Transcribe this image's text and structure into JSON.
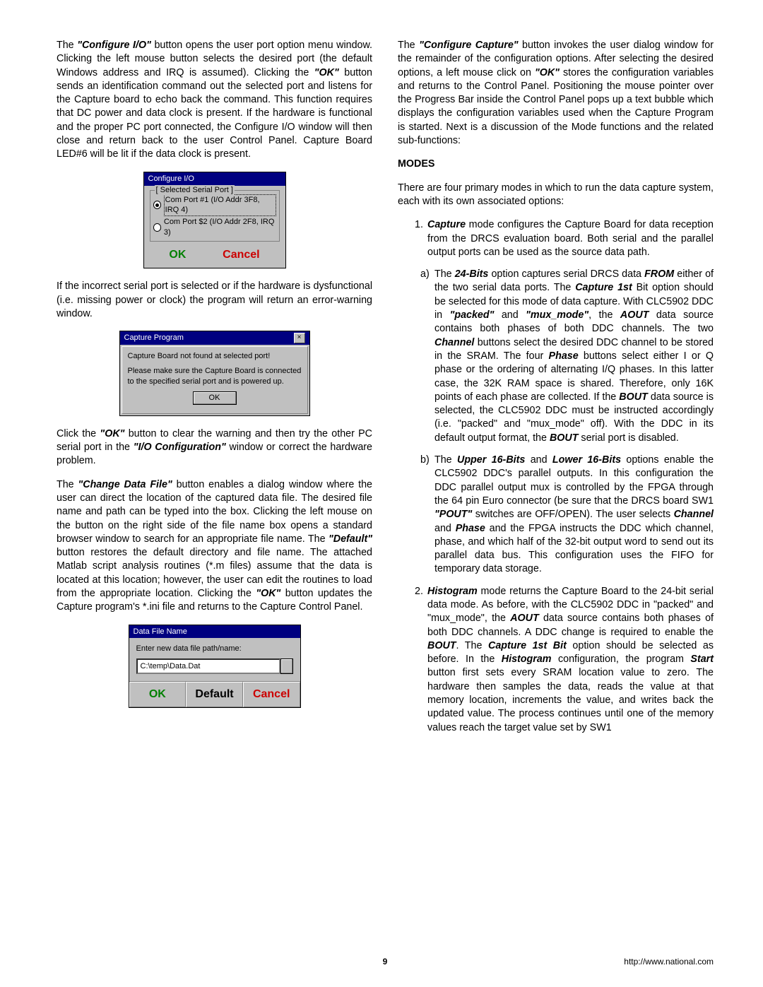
{
  "left": {
    "p1_pre": "The ",
    "p1_cfgio": "\"Configure I/O\"",
    "p1_mid": " button opens the user port option menu window. Clicking the left mouse button selects the desired port (the default Windows address and IRQ is assumed). Clicking the ",
    "p1_ok": "\"OK\"",
    "p1_post": " button sends an identification command out the selected port and listens for the Capture board to echo back the command. This function requires that DC power and data clock is present. If the hardware is functional and the proper PC port connected, the Configure I/O window will then close and return back to the user Control Panel. Capture Board LED#6 will be lit if the data clock is present.",
    "p2": "If the incorrect serial port is selected or if the hardware is dysfunctional (i.e. missing power or clock) the program will return an error-warning window.",
    "p3_pre": "Click the ",
    "p3_ok": "\"OK\"",
    "p3_mid": " button to clear the warning and then try the other PC serial port in the ",
    "p3_iocfg": "\"I/O Configuration\"",
    "p3_post": " window or correct the hardware problem.",
    "p4_pre": "The ",
    "p4_cdf": "\"Change Data File\"",
    "p4_mid": " button enables a dialog window where the user can direct the location of the captured data file. The desired file name and path can be typed into the box. Clicking the left mouse on the button on the right side of the file name box opens a standard browser window to search for an appropriate file name.    The ",
    "p4_def": "\"Default\"",
    "p4_mid2": " button restores the default directory and file name. The attached Matlab script analysis routines (*.m files) assume that the data is located at this location; however, the user can edit the routines to load from the appropriate location. Clicking the ",
    "p4_ok": "\"OK\"",
    "p4_post": " button updates the Capture program's *.ini file and returns to the Capture Control Panel."
  },
  "dlg_io": {
    "title": "Configure I/O",
    "legend": "[ Selected Serial Port ]",
    "opt1": "Com Port #1 (I/O Addr 3F8, IRQ 4)",
    "opt2": "Com Port $2 (I/O Addr 2F8, IRQ 3)",
    "ok": "OK",
    "cancel": "Cancel"
  },
  "dlg_cp": {
    "title": "Capture Program",
    "line1": "Capture Board not found at selected port!",
    "line2": "Please make sure the Capture Board is connected to the specified serial port and is powered up.",
    "ok": "OK"
  },
  "dlg_dfn": {
    "title": "Data File Name",
    "label": "Enter new data file path/name:",
    "value": "C:\\temp\\Data.Dat",
    "ok": "OK",
    "default": "Default",
    "cancel": "Cancel"
  },
  "right": {
    "p1_pre": "The ",
    "p1_cfgcap": "\"Configure Capture\"",
    "p1_mid": " button invokes the user dialog window for the remainder of the configuration options. After selecting the desired options, a left mouse click on ",
    "p1_ok": "\"OK\"",
    "p1_post": " stores the configuration variables and returns to the Control Panel. Positioning the mouse pointer over the Progress Bar inside the Control Panel pops up a text bubble which displays the configuration variables used when the Capture Program is started. Next is a discussion of the Mode functions and the related sub-functions:",
    "modes_head": "MODES",
    "modes_intro": "There are four primary modes in which to run the data capture system, each with its own associated options:",
    "n1_marker": "1.",
    "n1_cap": "Capture",
    "n1_text": " mode configures the Capture Board for data reception from the DRCS evaluation board. Both serial and the parallel output ports can be used as the source data path.",
    "a_marker": "a)",
    "a_pre": "The ",
    "a_24b": "24-Bits",
    "a_m1": " option captures serial DRCS data ",
    "a_from": "FROM",
    "a_m2": " either of the two serial data ports. The ",
    "a_c1st": "Capture 1st",
    "a_m3": " Bit option should be selected for this mode of data capture. With CLC5902 DDC in ",
    "a_pack": "\"packed\"",
    "a_and": " and ",
    "a_mux": "\"mux_mode\"",
    "a_m4": ", the ",
    "a_aout": "AOUT",
    "a_m5": " data source contains both phases of both DDC channels. The two ",
    "a_ch": "Channel",
    "a_m6": " buttons select the desired DDC channel to be stored in the SRAM. The four ",
    "a_ph": "Phase",
    "a_m7": " buttons select either I or Q phase or the ordering of alternating I/Q phases. In this latter case, the 32K RAM space is shared. Therefore, only 16K points of each phase are collected. If the ",
    "a_bout": "BOUT",
    "a_m8": " data source is selected, the CLC5902 DDC must be instructed accordingly (i.e. \"packed\" and \"mux_mode\" off). With the DDC in its default output format, the ",
    "a_bout2": "BOUT",
    "a_m9": " serial port is disabled.",
    "b_marker": "b)",
    "b_pre": "The ",
    "b_u16": "Upper 16-Bits",
    "b_and": " and ",
    "b_l16": "Lower 16-Bits",
    "b_m1": " options enable the CLC5902 DDC's parallel outputs. In this configuration the DDC parallel output mux is controlled by the FPGA through the 64 pin Euro connector (be sure that the DRCS board SW1 ",
    "b_pout": "\"POUT\"",
    "b_m2": " switches are OFF/OPEN). The user selects ",
    "b_ch": "Channel",
    "b_and2": " and ",
    "b_ph": "Phase",
    "b_m3": " and the FPGA instructs the DDC which channel, phase, and which half of the 32-bit output word to send out its parallel data bus. This configuration uses the FIFO for temporary data storage.",
    "n2_marker": "2.",
    "n2_hist": "Histogram",
    "n2_m1": " mode returns the Capture Board to the 24-bit serial data mode. As before, with the CLC5902 DDC in \"packed\" and \"mux_mode\", the ",
    "n2_aout": "AOUT",
    "n2_m2": " data source contains both phases of both DDC channels. A DDC change is required to enable the ",
    "n2_bout": "BOUT",
    "n2_m3": ". The ",
    "n2_c1st": "Capture 1st Bit",
    "n2_m4": " option should be selected as before. In the ",
    "n2_histc": "Histogram",
    "n2_m5": " configuration, the program ",
    "n2_start": "Start",
    "n2_m6": " button first sets every SRAM location value to zero. The hardware then samples the data, reads the value at that memory location, increments the value, and writes back the updated value. The process continues until one of the memory values reach the target value set by SW1"
  },
  "footer": {
    "page": "9",
    "url": "http://www.national.com"
  }
}
